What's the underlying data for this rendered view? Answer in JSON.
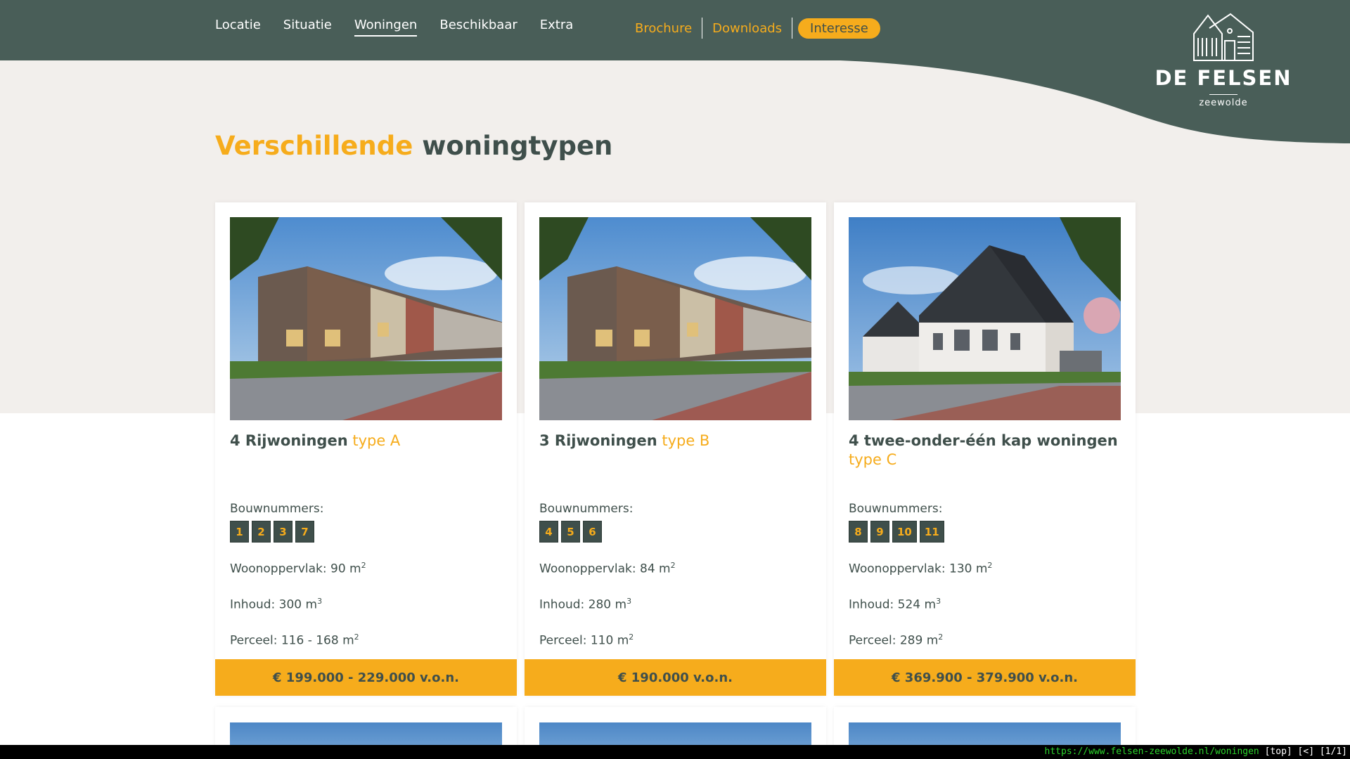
{
  "nav": {
    "items": [
      "Locatie",
      "Situatie",
      "Woningen",
      "Beschikbaar",
      "Extra"
    ],
    "active": "Woningen",
    "brochure": "Brochure",
    "downloads": "Downloads",
    "interesse": "Interesse"
  },
  "logo": {
    "name": "DE FELSEN",
    "sub": "zeewolde"
  },
  "heading": {
    "highlight": "Verschillende",
    "rest": "woningtypen"
  },
  "cards": [
    {
      "title": "4 Rijwoningen",
      "type": "type A",
      "bouw_label": "Bouwnummers:",
      "bouwnummers": [
        "1",
        "2",
        "3",
        "7"
      ],
      "woonopp": "Woonoppervlak: 90 m",
      "inhoud": "Inhoud: 300 m",
      "perceel": "Perceel: 116 - 168 m",
      "price": "€ 199.000 - 229.000 v.o.n."
    },
    {
      "title": "3 Rijwoningen",
      "type": "type B",
      "bouw_label": "Bouwnummers:",
      "bouwnummers": [
        "4",
        "5",
        "6"
      ],
      "woonopp": "Woonoppervlak: 84 m",
      "inhoud": "Inhoud: 280 m",
      "perceel": "Perceel: 110 m",
      "price": "€ 190.000 v.o.n."
    },
    {
      "title": "4 twee-onder-één kap woningen",
      "type": "type C",
      "bouw_label": "Bouwnummers:",
      "bouwnummers": [
        "8",
        "9",
        "10",
        "11"
      ],
      "woonopp": "Woonoppervlak: 130 m",
      "inhoud": "Inhoud: 524 m",
      "perceel": "Perceel: 289 m",
      "price": "€ 369.900 - 379.900 v.o.n."
    }
  ],
  "sup": {
    "two": "2",
    "three": "3"
  },
  "statusbar": {
    "url": "https://www.felsen-zeewolde.nl/woningen",
    "rest": "[top] [<] [1/1]"
  },
  "colors": {
    "header": "#495e58",
    "accent": "#f6ac1c",
    "beige": "#f2efec",
    "text": "#3f4f4b"
  }
}
